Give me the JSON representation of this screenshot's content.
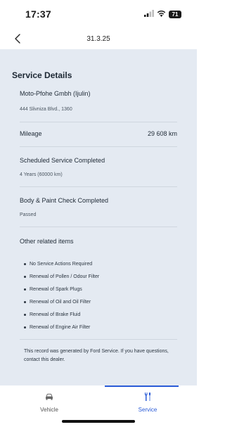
{
  "status_bar": {
    "time": "17:37",
    "battery": "71",
    "icons": [
      "signal-icon",
      "wifi-icon",
      "battery-icon"
    ]
  },
  "nav": {
    "title": "31.3.25",
    "back_icon": "chevron-left-icon"
  },
  "details": {
    "section_title": "Service Details",
    "dealer_name": "Moto-Pfohe Gmbh (Ijulin)",
    "dealer_address": "444 Slivniza Blvd., 1360",
    "mileage_label": "Mileage",
    "mileage_value": "29 608 km",
    "scheduled_title": "Scheduled Service Completed",
    "scheduled_sub": "4 Years (60000 km)",
    "body_title": "Body & Paint Check Completed",
    "body_sub": "Passed",
    "other_title": "Other related items",
    "other_items": [
      "No Service Actions Required",
      "Renewal of Pollen / Odour Filter",
      "Renewal of Spark Plugs",
      "Renewal of Oil and Oil Filter",
      "Renewal of Brake Fluid",
      "Renewal of Engine Air Filter"
    ],
    "footer_note": "This record was generated by Ford Service. If you have questions, contact this dealer."
  },
  "tabs": [
    {
      "label": "Vehicle",
      "icon": "car-icon",
      "active": false
    },
    {
      "label": "Service",
      "icon": "wrench-screwdriver-icon",
      "active": true
    }
  ],
  "colors": {
    "accent": "#2a5bd7",
    "content_background": "#e4eaf2"
  }
}
